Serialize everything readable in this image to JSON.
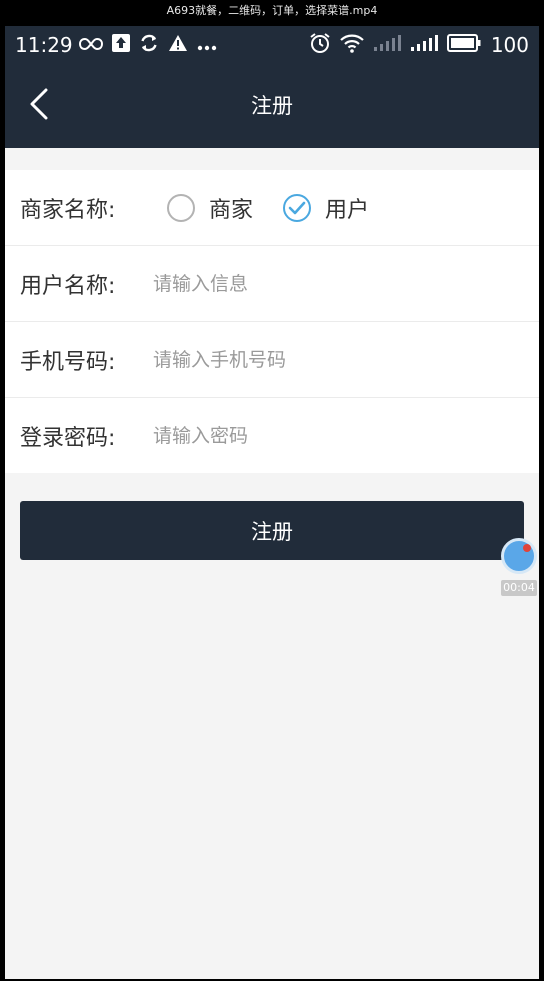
{
  "window": {
    "title": "A693就餐，二维码，订单，选择菜谱.mp4"
  },
  "statusbar": {
    "time": "11:29",
    "battery_level": "100",
    "left_icons": [
      "infinity-icon",
      "upload-icon",
      "sync-icon",
      "warning-icon",
      "more-icon"
    ],
    "right_icons": [
      "alarm-icon",
      "wifi-icon",
      "signal-weak-icon",
      "signal-icon",
      "battery-icon"
    ]
  },
  "navbar": {
    "title": "注册",
    "back_icon": "chevron-left-icon"
  },
  "form": {
    "merchant_type": {
      "label": "商家名称:",
      "options": [
        {
          "label": "商家",
          "checked": false
        },
        {
          "label": "用户",
          "checked": true
        }
      ]
    },
    "username": {
      "label": "用户名称:",
      "placeholder": "请输入信息",
      "value": ""
    },
    "phone": {
      "label": "手机号码:",
      "placeholder": "请输入手机号码",
      "value": ""
    },
    "password": {
      "label": "登录密码:",
      "placeholder": "请输入密码",
      "value": ""
    }
  },
  "register_button": {
    "label": "注册"
  },
  "recorder": {
    "timer": "00:04"
  },
  "colors": {
    "header_bg": "#212c3a",
    "page_bg": "#f4f4f4",
    "radio_checked": "#4aa8e0"
  }
}
